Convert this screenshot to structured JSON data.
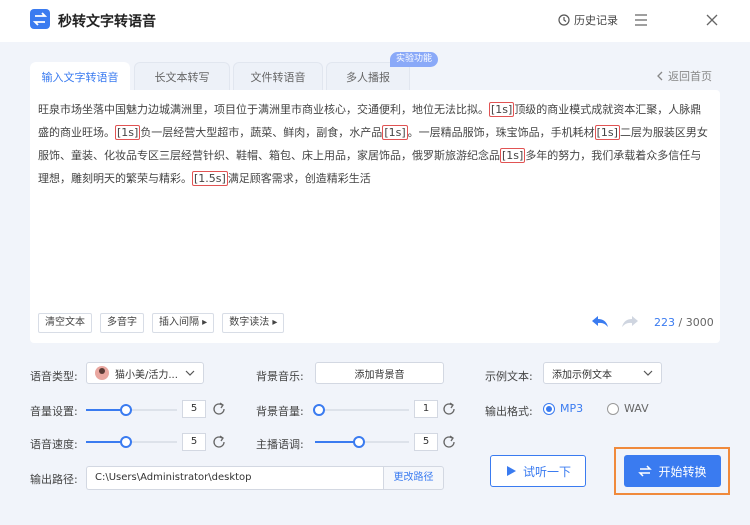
{
  "app": {
    "title": "秒转文字转语音",
    "history_label": "历史记录"
  },
  "tabs": [
    {
      "label": "输入文字转语音",
      "active": true
    },
    {
      "label": "长文本转写",
      "active": false
    },
    {
      "label": "文件转语音",
      "active": false
    },
    {
      "label": "多人播报",
      "active": false
    }
  ],
  "badge": "实验功能",
  "back_home": "返回首页",
  "editor": {
    "segments": [
      {
        "text": "旺泉市场坐落中国魅力边城满洲里，项目位于满洲里市商业核心，交通便利，地位无法比拟。",
        "mark": false
      },
      {
        "text": "[1s]",
        "mark": true
      },
      {
        "text": "顶级的商业模式成就资本汇聚，人脉鼎盛的商业旺场。",
        "mark": false
      },
      {
        "text": "[1s]",
        "mark": true
      },
      {
        "text": "负一层经营大型超市，蔬菜、鲜肉，副食，水产品",
        "mark": false
      },
      {
        "text": "[1s]",
        "mark": true
      },
      {
        "text": "。一层精品服饰，珠宝饰品，手机耗材",
        "mark": false
      },
      {
        "text": "[1s]",
        "mark": true
      },
      {
        "text": "二层为服装区男女服饰、童装、化妆品专区三层经营针织、鞋帽、箱包、床上用品，家居饰品，俄罗斯旅游纪念品",
        "mark": false
      },
      {
        "text": "[1s]",
        "mark": true
      },
      {
        "text": "多年的努力，我们承载着众多信任与理想，雕刻明天的繁荣与精彩。",
        "mark": false
      },
      {
        "text": "[1.5s]",
        "mark": true
      },
      {
        "text": "满足顾客需求，创造精彩生活",
        "mark": false
      }
    ],
    "buttons": {
      "clear": "清空文本",
      "polyphone": "多音字",
      "insert_pause": "插入间隔 ▸",
      "number_reading": "数字读法 ▸"
    },
    "count": "223",
    "count_sep": " / ",
    "count_max": "3000"
  },
  "settings": {
    "voice_type_label": "语音类型:",
    "voice_type_value": "猫小美/活力...",
    "bg_music_label": "背景音乐:",
    "bg_music_value": "添加背景音",
    "sample_text_label": "示例文本:",
    "sample_text_value": "添加示例文本",
    "volume_label": "音量设置:",
    "volume_value": 5,
    "bg_volume_label": "背景音量:",
    "bg_volume_value": 1,
    "output_format_label": "输出格式:",
    "format_mp3": "MP3",
    "format_wav": "WAV",
    "selected_format": "MP3",
    "speed_label": "语音速度:",
    "speed_value": 5,
    "pitch_label": "主播语调:",
    "pitch_value": 5,
    "output_path_label": "输出路径:",
    "output_path_value": "C:\\Users\\Administrator\\desktop",
    "change_path_label": "更改路径"
  },
  "actions": {
    "preview_label": "试听一下",
    "start_label": "开始转换"
  },
  "colors": {
    "accent": "#3a7bf0",
    "highlight_outline": "#f08a3c",
    "mark_border": "#e15353"
  }
}
